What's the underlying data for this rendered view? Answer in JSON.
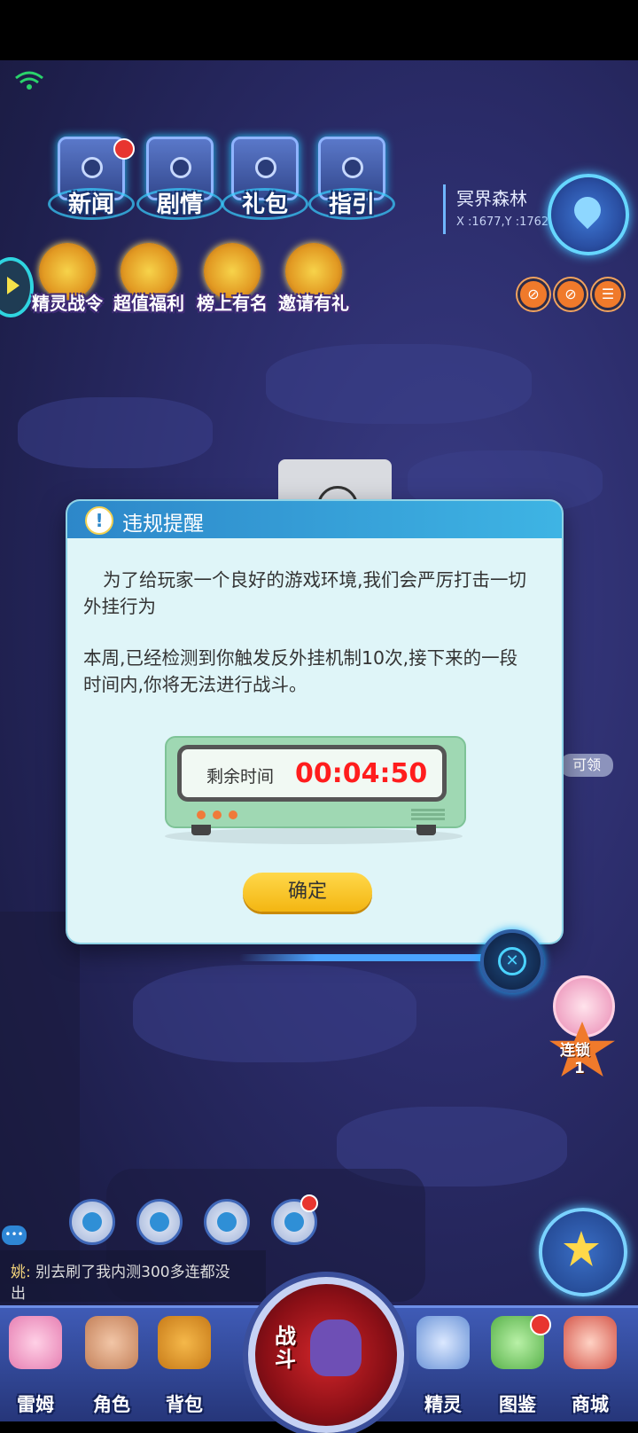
{
  "top_menu": [
    {
      "label": "新闻",
      "badge": true
    },
    {
      "label": "剧情",
      "badge": false
    },
    {
      "label": "礼包",
      "badge": false
    },
    {
      "label": "指引",
      "badge": false
    }
  ],
  "location": {
    "name": "冥界森林",
    "coords": "X :1677,Y :1762"
  },
  "welfare_menu": [
    "精灵战令",
    "超值福利",
    "榜上有名",
    "邀请有礼"
  ],
  "side_item_label": "可领",
  "dialog": {
    "title": "违规提醒",
    "paragraph1": "为了给玩家一个良好的游戏环境,我们会严厉打击一切外挂行为",
    "paragraph2": "本周,已经检测到你触发反外挂机制10次,接下来的一段时间内,你将无法进行战斗。",
    "timer_label": "剩余时间",
    "timer_value": "00:04:50",
    "confirm_label": "确定"
  },
  "streak": {
    "label": "连锁",
    "count": "1"
  },
  "chat": {
    "sender": "姚:",
    "message": " 别去刷了我内测300多连都没",
    "overflow": "出"
  },
  "bottom_nav": {
    "left": [
      "雷姆",
      "角色",
      "背包"
    ],
    "battle": "战斗",
    "right": [
      "精灵",
      "图鉴",
      "商城"
    ]
  },
  "colors": {
    "timer_red": "#ff1d1d",
    "confirm_yellow": "#ffd84a",
    "dialog_header_blue": "#2d87c9"
  }
}
